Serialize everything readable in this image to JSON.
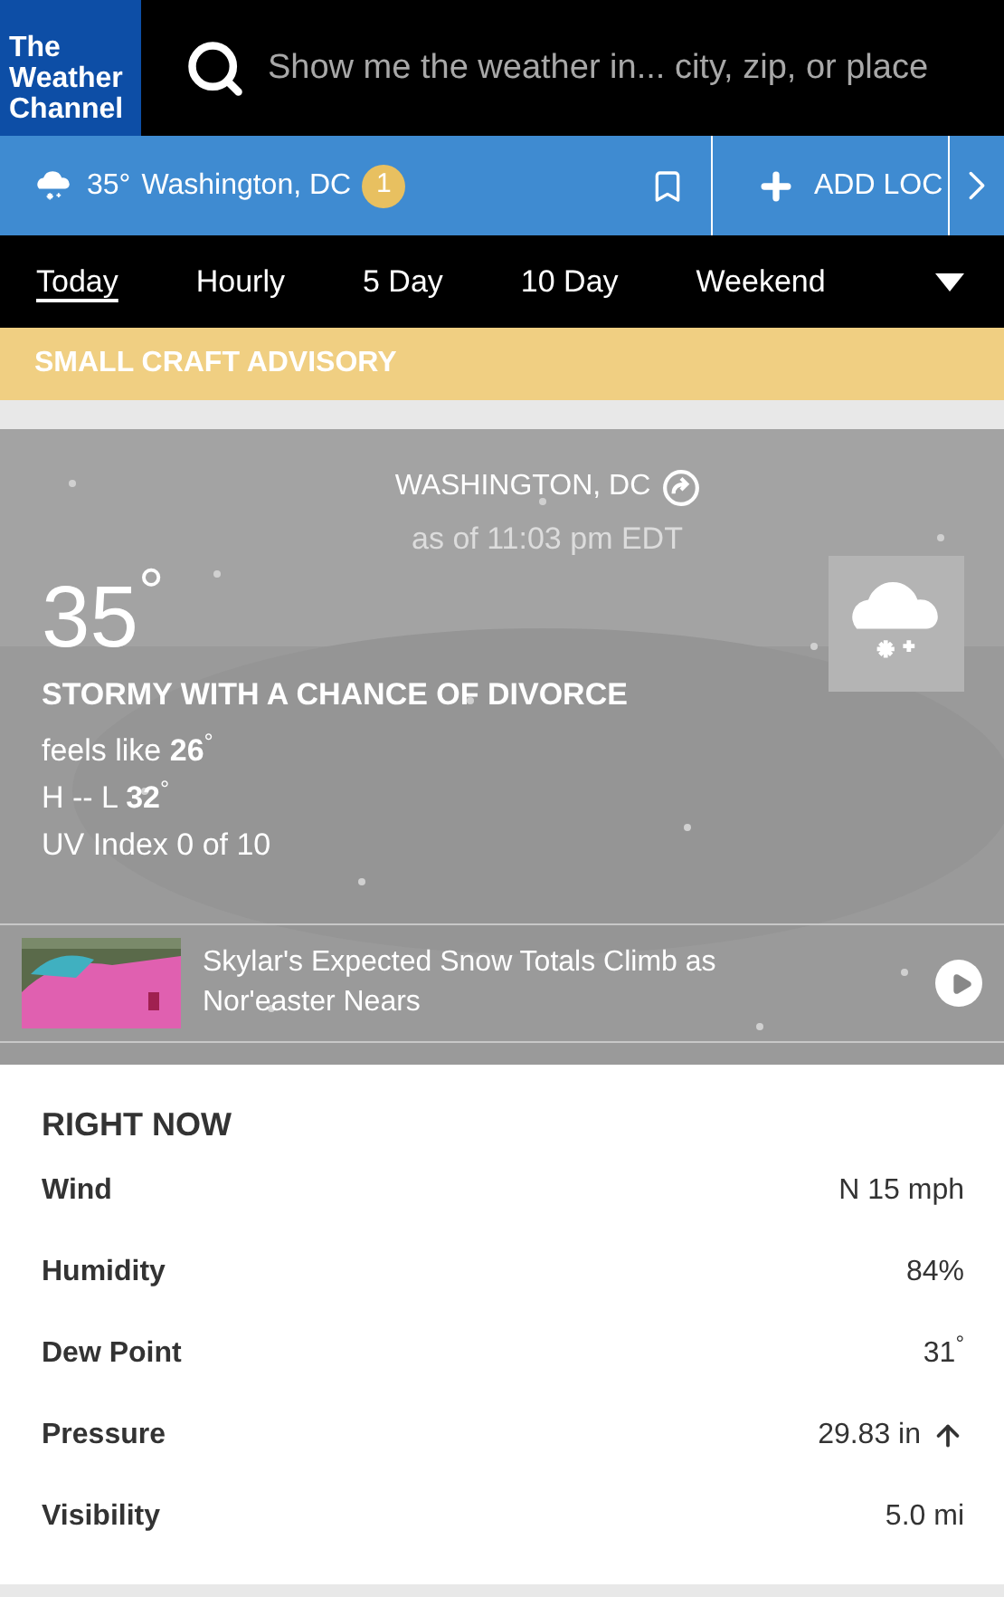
{
  "header": {
    "logo": "The Weather Channel",
    "search": {
      "placeholder": "Show me the weather in... city, zip, or place"
    }
  },
  "location_bar": {
    "temperature": "35°",
    "location": "Washington, DC",
    "badge": "1",
    "add_button": "ADD LOC"
  },
  "tabs": [
    {
      "label": "Today",
      "selected": true
    },
    {
      "label": "Hourly",
      "selected": false
    },
    {
      "label": "5 Day",
      "selected": false
    },
    {
      "label": "10 Day",
      "selected": false
    },
    {
      "label": "Weekend",
      "selected": false
    }
  ],
  "advisory": "SMALL CRAFT ADVISORY",
  "current": {
    "location": "WASHINGTON, DC",
    "as_of": "as of 11:03 pm EDT",
    "temperature": "35$^{°}$",
    "phrase": "STORMY WITH A CHANCE OF DIVORCE",
    "details": [
      "feels like **26**$^{°}$",
      "H -- L **32**$^{°}$",
      "UV Index 0 of 10"
    ],
    "video": {
      "title": "Skylar's Expected Snow Totals Climb as Nor'easter Nears"
    }
  },
  "right_now": {
    "title": "RIGHT NOW",
    "rows": [
      {
        "kind": "plain",
        "label": "Wind",
        "value": "N 15 mph"
      },
      {
        "kind": "plain",
        "label": "Humidity",
        "value": "84%"
      },
      {
        "kind": "plain",
        "label": "Dew Point",
        "value": "31$^{°}$"
      },
      {
        "kind": "rising",
        "label": "Pressure",
        "value": "29.83 in"
      },
      {
        "kind": "plain",
        "label": "Visibility",
        "value": "5.0 mi"
      }
    ]
  }
}
